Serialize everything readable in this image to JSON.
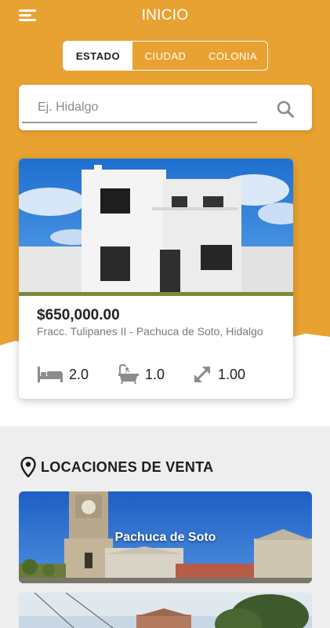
{
  "header": {
    "title": "INICIO",
    "menu_icon": "hamburger-menu-icon"
  },
  "filter_tabs": [
    {
      "label": "ESTADO",
      "active": true
    },
    {
      "label": "CIUDAD",
      "active": false
    },
    {
      "label": "COLONIA",
      "active": false
    }
  ],
  "search": {
    "placeholder": "Ej. Hidalgo",
    "value": "",
    "icon": "search-icon"
  },
  "listing": {
    "price": "$650,000.00",
    "address": "Fracc. Tulipanes II - Pachuca de Soto, Hidalgo",
    "features": [
      {
        "icon": "bed-icon",
        "value": "2.0"
      },
      {
        "icon": "bathtub-icon",
        "value": "1.0"
      },
      {
        "icon": "expand-arrows-icon",
        "value": "1.00"
      }
    ]
  },
  "locations": {
    "title": "LOCACIONES DE VENTA",
    "icon": "location-pin-icon",
    "items": [
      {
        "label": "Pachuca de Soto"
      },
      {
        "label": ""
      }
    ]
  },
  "colors": {
    "brand_orange": "#e8a232",
    "text_dark": "#222222",
    "text_muted": "#7a7a7a",
    "section_grey": "#eeeeee"
  }
}
